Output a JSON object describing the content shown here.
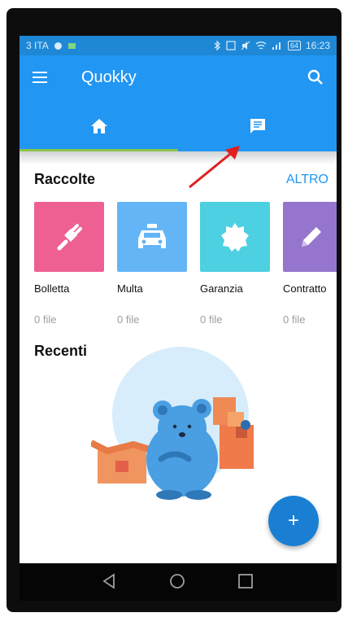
{
  "status": {
    "carrier": "3 ITA",
    "battery": "64",
    "time": "16:23"
  },
  "app": {
    "title": "Quokky"
  },
  "tabs": [
    {
      "name": "home",
      "icon": "home-icon"
    },
    {
      "name": "chat",
      "icon": "chat-icon"
    }
  ],
  "raccolte": {
    "title": "Raccolte",
    "more": "ALTRO",
    "items": [
      {
        "label": "Bolletta",
        "count": "0 file",
        "color": "#ee5f93",
        "icon": "plug-icon"
      },
      {
        "label": "Multa",
        "count": "0 file",
        "color": "#64b5f6",
        "icon": "taxi-icon"
      },
      {
        "label": "Garanzia",
        "count": "0 file",
        "color": "#4dd0e1",
        "icon": "badge-icon"
      },
      {
        "label": "Contratto",
        "count": "0 file",
        "color": "#9575cd",
        "icon": "pencil-icon"
      }
    ]
  },
  "recenti": {
    "title": "Recenti"
  },
  "fab": {
    "label": "+"
  },
  "colors": {
    "primary": "#2196f3",
    "status_bar": "#1e88d6",
    "tab_indicator": "#8bc34a",
    "fab": "#1a7fd3"
  }
}
